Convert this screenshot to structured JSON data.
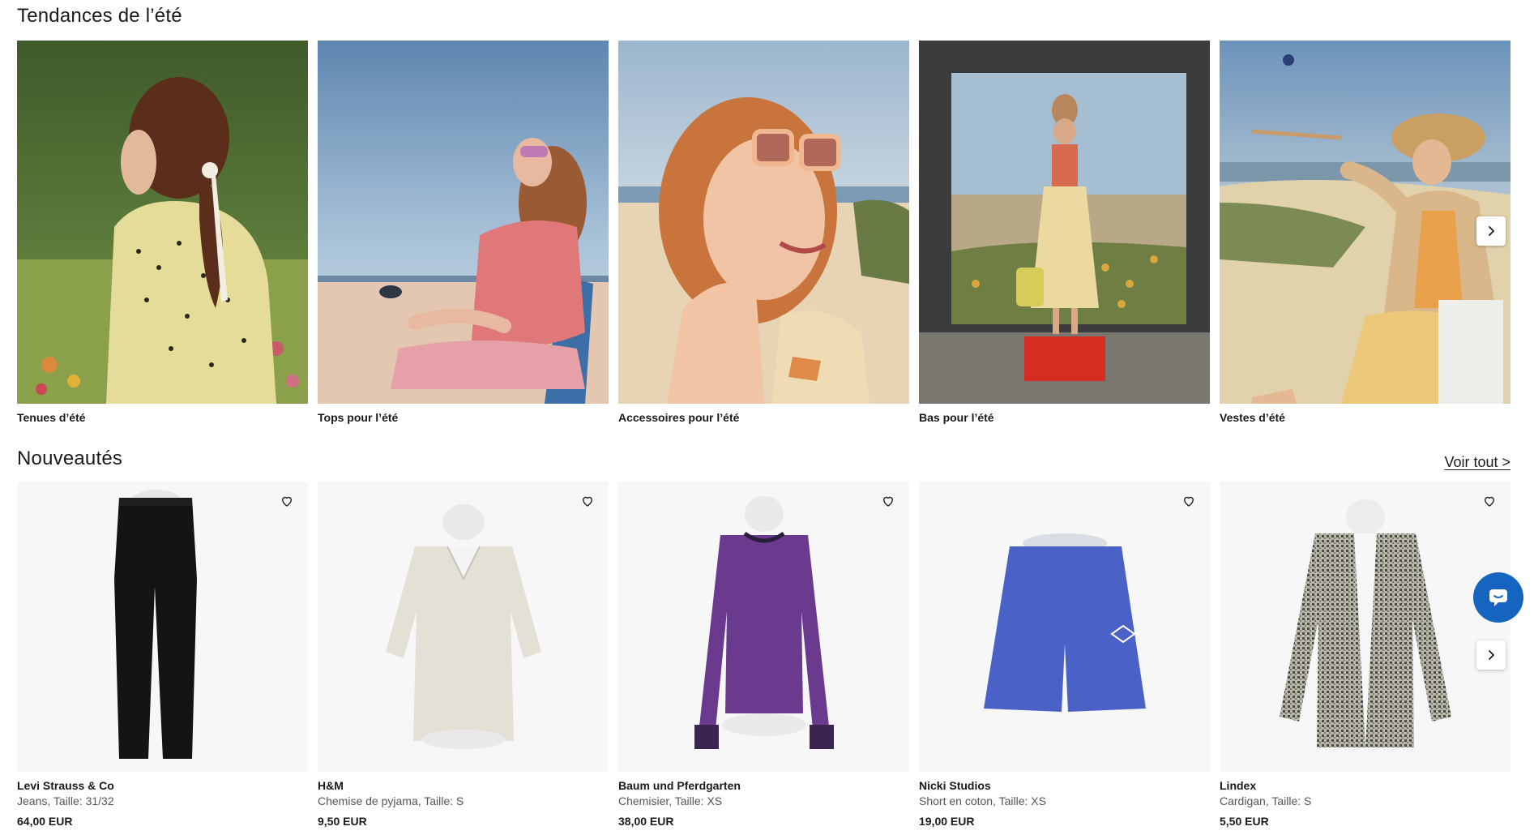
{
  "trends": {
    "title": "Tendances de l’été",
    "items": [
      {
        "label": "Tenues d’été"
      },
      {
        "label": "Tops pour l’été"
      },
      {
        "label": "Accessoires pour l’été"
      },
      {
        "label": "Bas pour l’été"
      },
      {
        "label": "Vestes d’été"
      }
    ]
  },
  "new_arrivals": {
    "title": "Nouveautés",
    "see_all": "Voir tout >",
    "items": [
      {
        "brand": "Levi Strauss & Co",
        "desc": "Jeans, Taille: 31/32",
        "price": "64,00 EUR"
      },
      {
        "brand": "H&M",
        "desc": "Chemise de pyjama, Taille: S",
        "price": "9,50 EUR"
      },
      {
        "brand": "Baum und Pferdgarten",
        "desc": "Chemisier, Taille: XS",
        "price": "38,00 EUR"
      },
      {
        "brand": "Nicki Studios",
        "desc": "Short en coton, Taille: XS",
        "price": "19,00 EUR"
      },
      {
        "brand": "Lindex",
        "desc": "Cardigan, Taille: S",
        "price": "5,50 EUR"
      }
    ]
  },
  "icons": {
    "favorite": "heart-icon",
    "next": "chevron-right-icon",
    "chat": "chat-icon"
  },
  "colors": {
    "chat_button": "#1565c0",
    "product_bg": "#f7f7f7"
  }
}
